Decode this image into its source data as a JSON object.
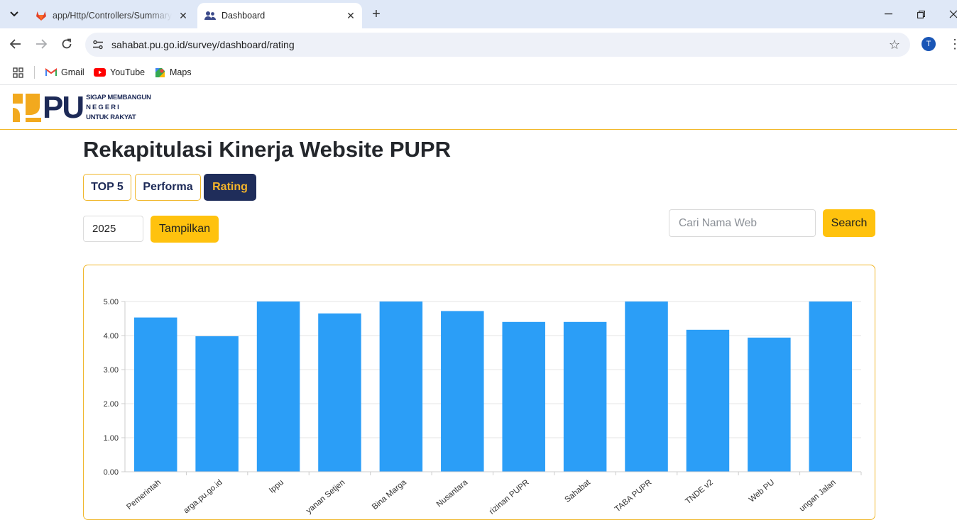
{
  "browser": {
    "tabs": [
      {
        "title": "app/Http/Controllers/Summary",
        "active": false,
        "icon": "gitlab-icon"
      },
      {
        "title": "Dashboard",
        "active": true,
        "icon": "users-icon"
      }
    ],
    "url": "sahabat.pu.go.id/survey/dashboard/rating",
    "profile_initial": "T",
    "bookmarks": [
      {
        "label": "Gmail",
        "icon": "gmail-icon"
      },
      {
        "label": "YouTube",
        "icon": "youtube-icon"
      },
      {
        "label": "Maps",
        "icon": "maps-icon"
      }
    ]
  },
  "header": {
    "logo_text": "PU",
    "tagline": [
      "SIGAP MEMBANGUN",
      "N E G E R I",
      "UNTUK RAKYAT"
    ]
  },
  "page": {
    "title": "Rekapitulasi Kinerja Website PUPR",
    "tabs": [
      {
        "label": "TOP 5",
        "active": false
      },
      {
        "label": "Performa",
        "active": false
      },
      {
        "label": "Rating",
        "active": true
      }
    ],
    "year_value": "2025",
    "show_button": "Tampilkan",
    "search_placeholder": "Cari Nama Web",
    "search_button": "Search"
  },
  "colors": {
    "accent_yellow": "#ffc20e",
    "navy": "#1f2d5a",
    "bar": "#2b9ef7"
  },
  "chart_data": {
    "type": "bar",
    "categories": [
      "Pemerintah",
      "arga.pu.go.id",
      "Ippu",
      "yanan Setjen",
      "Bina Marga",
      "Nusantara",
      "rizinan PUPR",
      "Sahabat",
      "TABA PUPR",
      "TNDE v2",
      "Web PU",
      "ungan Jalan"
    ],
    "values": [
      4.53,
      3.98,
      5.0,
      4.65,
      5.0,
      4.72,
      4.4,
      4.4,
      5.0,
      4.17,
      3.94,
      5.0
    ],
    "ylim": [
      0,
      5
    ],
    "yticks": [
      "0.00",
      "1.00",
      "2.00",
      "3.00",
      "4.00",
      "5.00"
    ],
    "grid": true
  }
}
